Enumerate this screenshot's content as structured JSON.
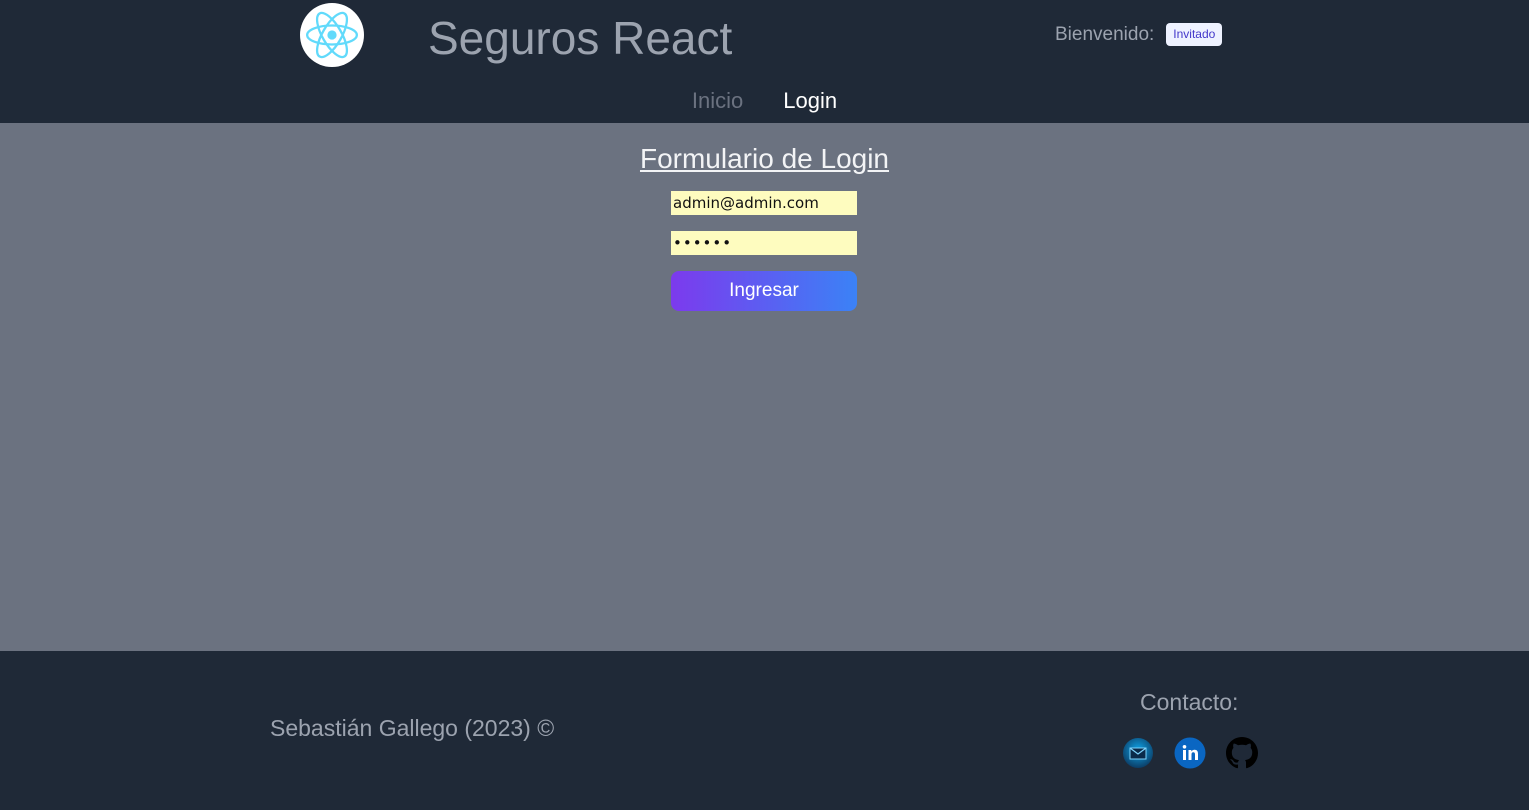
{
  "header": {
    "title": "Seguros React",
    "welcome_label": "Bienvenido:",
    "user": "Invitado",
    "nav": [
      {
        "label": "Inicio",
        "active": false
      },
      {
        "label": "Login",
        "active": true
      }
    ]
  },
  "login_form": {
    "title": "Formulario de Login",
    "email_value": "admin@admin.com",
    "password_value": "admin1",
    "submit_label": "Ingresar"
  },
  "footer": {
    "copyright": "Sebastián Gallego (2023) ©",
    "contact_label": "Contacto:",
    "social": [
      "mail-icon",
      "linkedin-icon",
      "github-icon"
    ]
  },
  "colors": {
    "header_bg": "#1f2937",
    "main_bg": "#6b7280",
    "input_bg": "#fefcbf",
    "button_gradient_start": "#7c3aed",
    "button_gradient_end": "#3b82f6",
    "react_logo": "#61dafb"
  }
}
